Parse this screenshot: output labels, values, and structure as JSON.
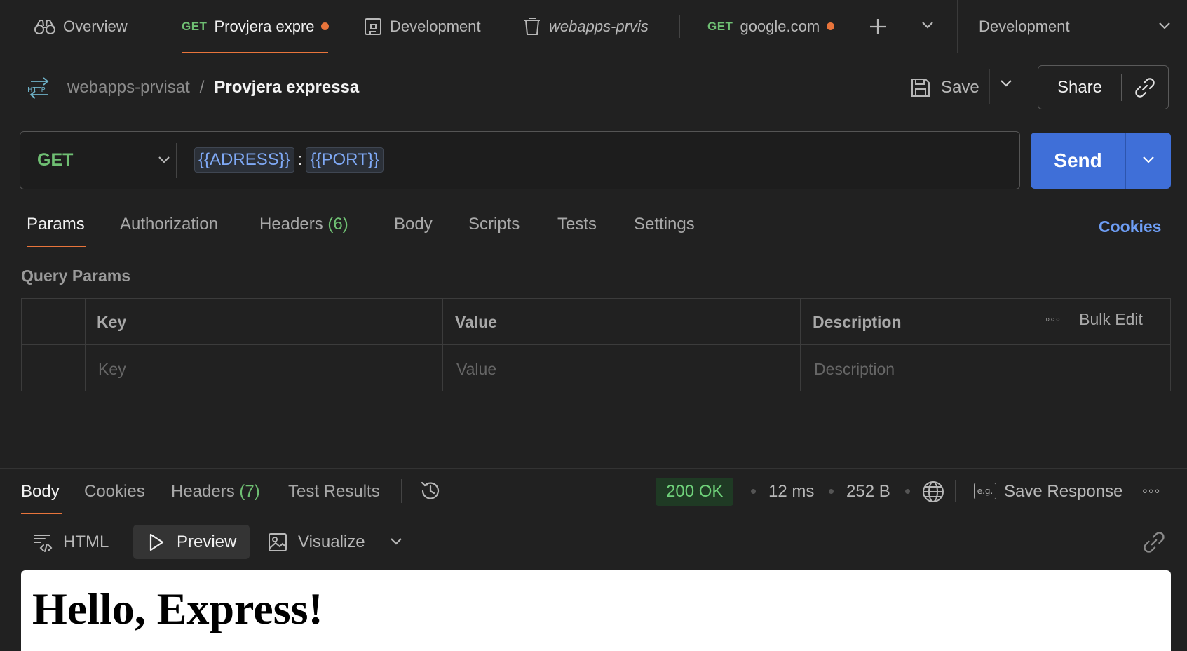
{
  "colors": {
    "accent": "#e8743b",
    "method_get": "#6fbf73",
    "send_button": "#3f6fd8",
    "variable": "#7fa9f5",
    "link": "#6e9ef5",
    "status_ok_bg": "#1f3a24",
    "status_ok_text": "#6fd17a"
  },
  "tabs": {
    "overview": "Overview",
    "request_method": "GET",
    "request_name": "Provjera expre",
    "environment": "Development",
    "collection": "webapps-prvis",
    "google_method": "GET",
    "google_name": "google.com"
  },
  "environment_selector": {
    "label": "Development"
  },
  "breadcrumb": {
    "collection": "webapps-prvisat",
    "separator": "/",
    "request": "Provjera expressa"
  },
  "toolbar": {
    "save_label": "Save",
    "share_label": "Share"
  },
  "request": {
    "method": "GET",
    "url_var1": "{{ADRESS}}",
    "url_colon": ":",
    "url_var2": "{{PORT}}",
    "send_label": "Send"
  },
  "request_tabs": {
    "params": "Params",
    "authorization": "Authorization",
    "headers": "Headers",
    "headers_count": "(6)",
    "body": "Body",
    "scripts": "Scripts",
    "tests": "Tests",
    "settings": "Settings",
    "cookies": "Cookies"
  },
  "query_params": {
    "title": "Query Params",
    "columns": {
      "key": "Key",
      "value": "Value",
      "description": "Description"
    },
    "bulk_edit": "Bulk Edit",
    "placeholders": {
      "key": "Key",
      "value": "Value",
      "description": "Description"
    }
  },
  "response": {
    "tabs": {
      "body": "Body",
      "cookies": "Cookies",
      "headers": "Headers",
      "headers_count": "(7)",
      "test_results": "Test Results"
    },
    "status": "200 OK",
    "time": "12 ms",
    "size": "252 B",
    "eg_label": "e.g.",
    "save_response": "Save Response"
  },
  "response_view": {
    "html": "HTML",
    "preview": "Preview",
    "visualize": "Visualize"
  },
  "preview_content": {
    "heading": "Hello, Express!"
  }
}
